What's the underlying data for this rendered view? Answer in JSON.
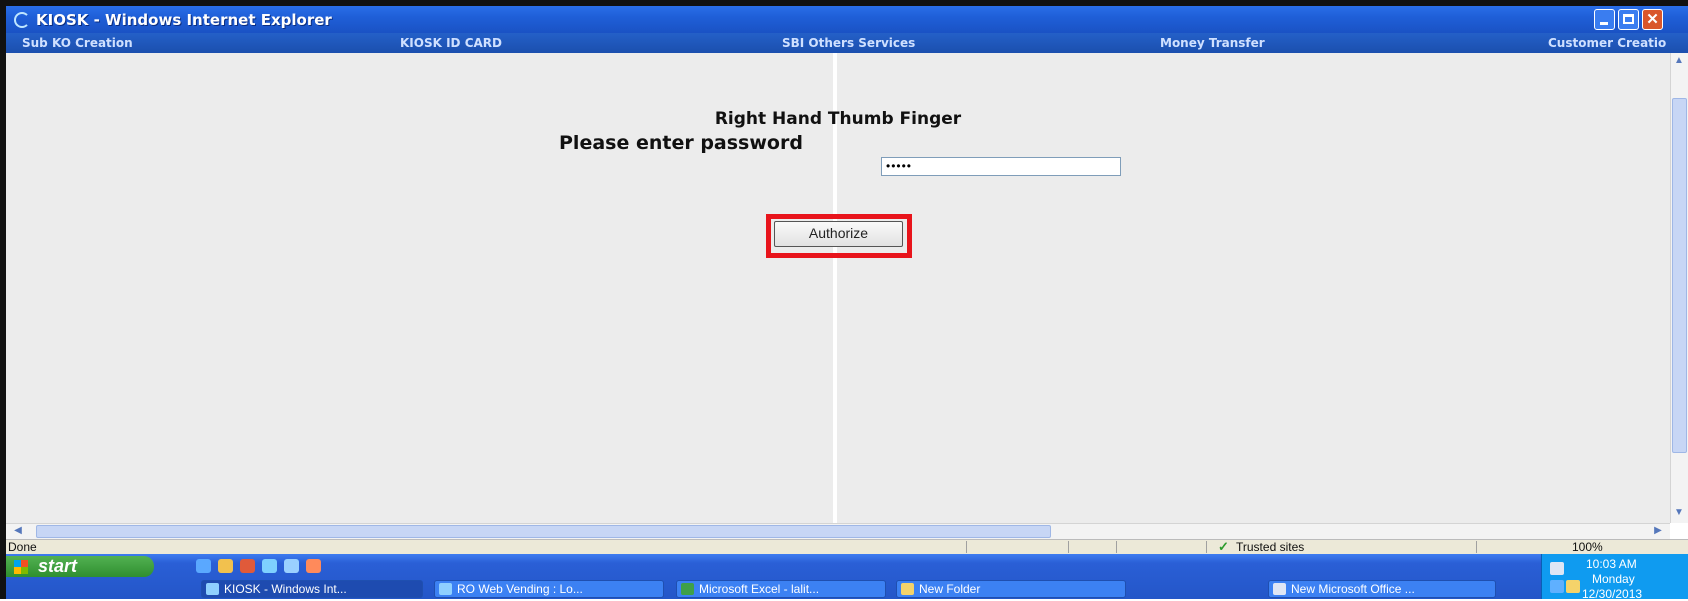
{
  "window": {
    "title": "KIOSK - Windows Internet Explorer",
    "close_glyph": "✕"
  },
  "menu": {
    "items": [
      {
        "label": "Sub KO Creation"
      },
      {
        "label": "KIOSK ID CARD"
      },
      {
        "label": "SBI Others Services"
      },
      {
        "label": "Money Transfer"
      },
      {
        "label": "Customer Creatio"
      }
    ]
  },
  "form": {
    "title": "Right Hand Thumb Finger",
    "password_label": "Please enter password",
    "password_value": "•••••",
    "authorize_label": "Authorize"
  },
  "status": {
    "text": "Done",
    "zone": "Trusted sites",
    "zoom": "100%"
  },
  "taskbar": {
    "start_label": "start",
    "items": [
      {
        "label": "KIOSK - Windows Int..."
      },
      {
        "label": "RO Web Vending : Lo..."
      },
      {
        "label": "Microsoft Excel - lalit..."
      },
      {
        "label": "New Folder"
      },
      {
        "label": "New Microsoft Office ..."
      }
    ],
    "clock": {
      "time": "10:03 AM",
      "day": "Monday",
      "date": "12/30/2013"
    }
  },
  "colors": {
    "highlight": "#e8141b",
    "titlebar": "#1f5fd8",
    "content_bg": "#ececec"
  }
}
